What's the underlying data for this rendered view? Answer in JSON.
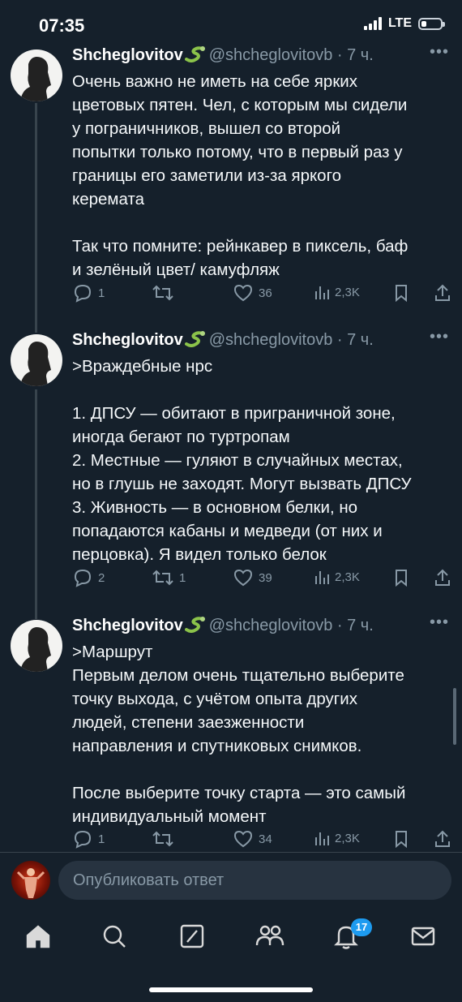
{
  "status_bar": {
    "time": "07:35",
    "network": "LTE",
    "battery_level": 0.25
  },
  "tweets": [
    {
      "name": "Shcheglovitov",
      "handle": "@shcheglovitovb",
      "time": "· 7 ч.",
      "lines": [
        "Очень важно не иметь на себе ярких",
        "цветовых пятен. Чел, с которым мы сидели",
        "у пограничников, вышел со второй",
        "попытки только потому, что в первый раз у",
        "границы его заметили из-за яркого",
        "керемата",
        "",
        "Так что помните: рейнкавер в пиксель, баф",
        "и зелёный цвет/ камуфляж"
      ],
      "replies": "1",
      "retweets": "",
      "likes": "36",
      "views": "2,3K"
    },
    {
      "name": "Shcheglovitov",
      "handle": "@shcheglovitovb",
      "time": "· 7 ч.",
      "lines": [
        ">Враждебные нрс",
        "",
        "1. ДПСУ — обитают в приграничной зоне,",
        "иногда бегают по туртропам",
        "2. Местные — гуляют в случайных местах,",
        "но в глушь не заходят. Могут вызвать ДПСУ",
        "3. Живность — в основном белки, но",
        "попадаются кабаны и медведи (от них и",
        "перцовка). Я видел только белок"
      ],
      "replies": "2",
      "retweets": "1",
      "likes": "39",
      "views": "2,3K"
    },
    {
      "name": "Shcheglovitov",
      "handle": "@shcheglovitovb",
      "time": "· 7 ч.",
      "lines": [
        ">Маршрут",
        "Первым делом очень тщательно выберите",
        "точку выхода, с учётом опыта других",
        "людей, степени заезженности",
        "направления и спутниковых снимков.",
        "",
        "После выберите точку старта — это самый",
        "индивидуальный момент"
      ],
      "replies": "1",
      "retweets": "",
      "likes": "34",
      "views": "2,3K"
    }
  ],
  "reply": {
    "placeholder": "Опубликовать ответ"
  },
  "tabbar": {
    "items": [
      "home-icon",
      "search-icon",
      "grok-icon",
      "communities-icon",
      "notifications-icon",
      "messages-icon"
    ],
    "notifications_badge": "17"
  },
  "colors": {
    "background": "#15202b",
    "text": "#f5f8fa",
    "muted": "#8899a6",
    "accent": "#1d9bf0"
  }
}
